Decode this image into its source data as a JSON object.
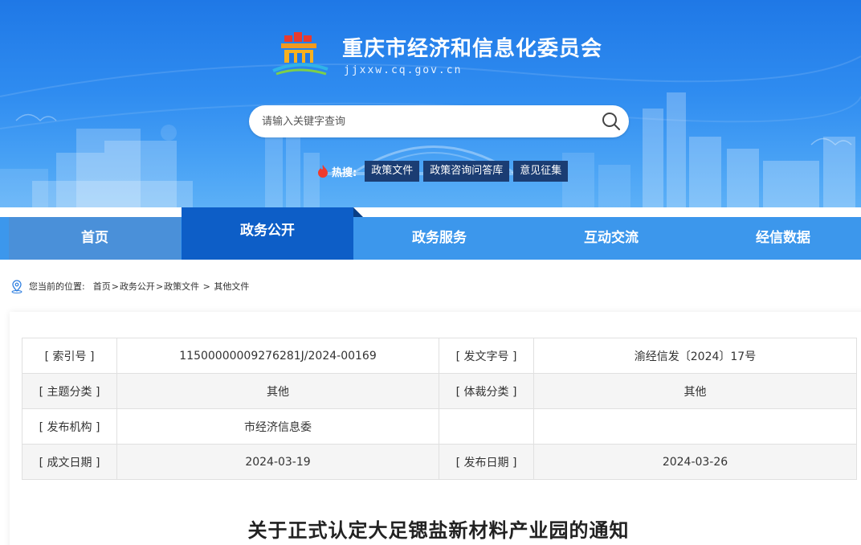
{
  "header": {
    "site_title": "重庆市经济和信息化委员会",
    "site_domain": "jjxxw.cq.gov.cn"
  },
  "search": {
    "placeholder": "请输入关键字查询"
  },
  "hot_search": {
    "label": "热搜:",
    "tags": [
      "政策文件",
      "政策咨询问答库",
      "意见征集"
    ]
  },
  "nav": {
    "items": [
      "首页",
      "政务公开",
      "政务服务",
      "互动交流",
      "经信数据"
    ],
    "active": "政务公开"
  },
  "breadcrumb": {
    "prefix": "您当前的位置:",
    "items": [
      "首页",
      "政务公开",
      "政策文件",
      "其他文件"
    ],
    "separators": [
      ">",
      ">",
      " > "
    ]
  },
  "meta_table": {
    "rows": [
      [
        "[ 索引号 ]",
        "11500000009276281J/2024-00169",
        "[ 发文字号 ]",
        "渝经信发〔2024〕17号"
      ],
      [
        "[ 主题分类 ]",
        "其他",
        "[ 体裁分类 ]",
        "其他"
      ],
      [
        "[ 发布机构 ]",
        "市经济信息委",
        "",
        ""
      ],
      [
        "[ 成文日期 ]",
        "2024-03-19",
        "[ 发布日期 ]",
        "2024-03-26"
      ]
    ]
  },
  "document": {
    "title": "关于正式认定大足锶盐新材料产业园的通知"
  },
  "colors": {
    "banner": "#2f8cf0",
    "nav": "#3c97ec",
    "nav_active": "#0d5ec7",
    "hot_tag": "#1b3d73"
  }
}
